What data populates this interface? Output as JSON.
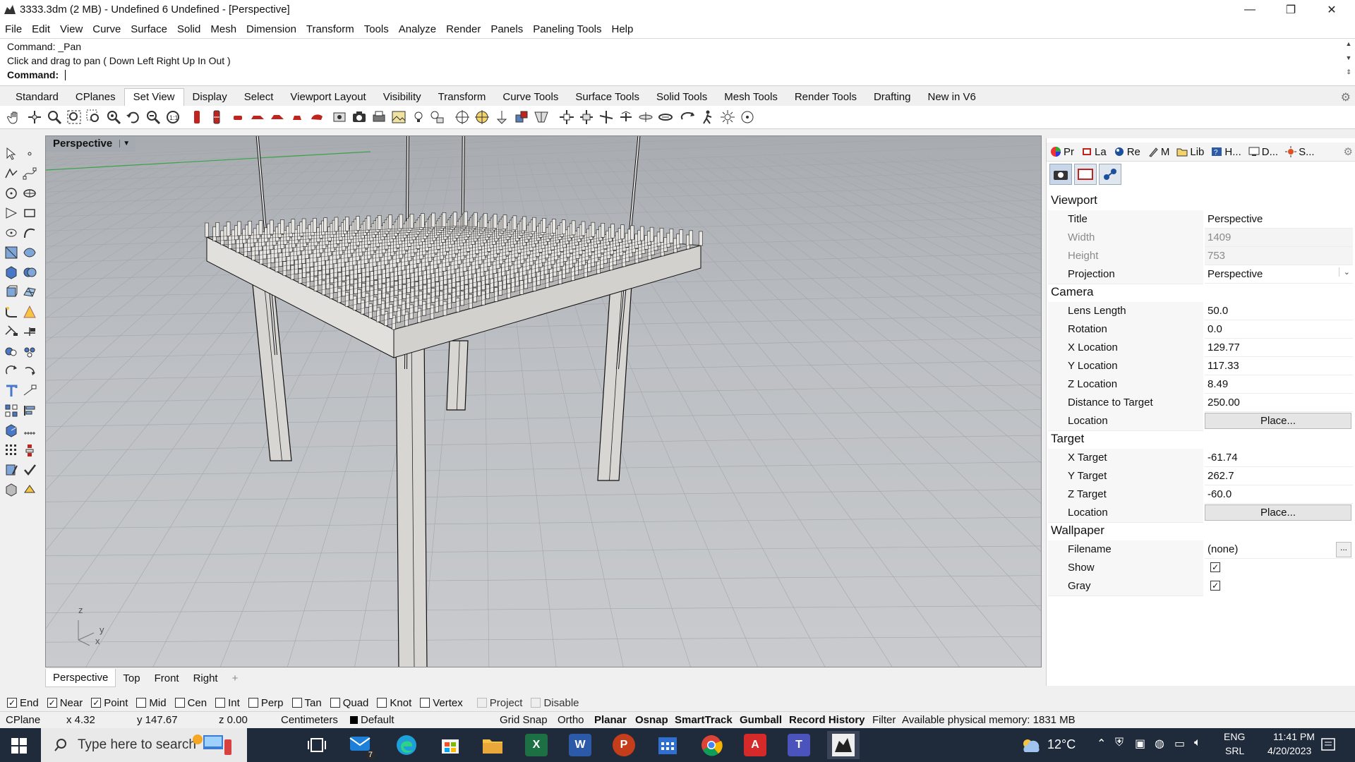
{
  "window": {
    "title": "3333.3dm (2 MB) - Undefined 6 Undefined - [Perspective]",
    "controls": [
      "—",
      "❐",
      "✕"
    ]
  },
  "menu": [
    "File",
    "Edit",
    "View",
    "Curve",
    "Surface",
    "Solid",
    "Mesh",
    "Dimension",
    "Transform",
    "Tools",
    "Analyze",
    "Render",
    "Panels",
    "Paneling Tools",
    "Help"
  ],
  "command": {
    "history_1": "Command: _Pan",
    "history_2": "Click and drag to pan ( Down  Left  Right  Up  In  Out )",
    "prompt_label": "Command:",
    "value": ""
  },
  "toolbar_tabs": [
    "Standard",
    "CPlanes",
    "Set View",
    "Display",
    "Select",
    "Viewport Layout",
    "Visibility",
    "Transform",
    "Curve Tools",
    "Surface Tools",
    "Solid Tools",
    "Mesh Tools",
    "Render Tools",
    "Drafting",
    "New in V6"
  ],
  "active_toolbar_tab": "Set View",
  "viewport": {
    "label": "Perspective",
    "axis_z": "z",
    "axis_y": "y",
    "axis_x": "x",
    "background_top": "#a8acb0",
    "background_bottom": "#c9cbce"
  },
  "viewport_tabs": [
    "Perspective",
    "Top",
    "Front",
    "Right"
  ],
  "viewport_tab_add": "+",
  "panel": {
    "tabs": [
      {
        "label": "Pr",
        "icon": "color-wheel-icon"
      },
      {
        "label": "La",
        "icon": "layers-icon"
      },
      {
        "label": "Re",
        "icon": "render-icon"
      },
      {
        "label": "M",
        "icon": "materials-icon"
      },
      {
        "label": "Lib",
        "icon": "folder-icon"
      },
      {
        "label": "H...",
        "icon": "help-icon"
      },
      {
        "label": "D...",
        "icon": "display-icon"
      },
      {
        "label": "S...",
        "icon": "sun-icon"
      }
    ],
    "sections": {
      "viewport": "Viewport",
      "camera": "Camera",
      "target": "Target",
      "wallpaper": "Wallpaper"
    },
    "fields": {
      "title_label": "Title",
      "title_value": "Perspective",
      "width_label": "Width",
      "width_value": "1409",
      "height_label": "Height",
      "height_value": "753",
      "projection_label": "Projection",
      "projection_value": "Perspective",
      "lens_label": "Lens Length",
      "lens_value": "50.0",
      "rotation_label": "Rotation",
      "rotation_value": "0.0",
      "xloc_label": "X Location",
      "xloc_value": "129.77",
      "yloc_label": "Y Location",
      "yloc_value": "117.33",
      "zloc_label": "Z Location",
      "zloc_value": "8.49",
      "dist_label": "Distance to Target",
      "dist_value": "250.00",
      "cam_location_label": "Location",
      "place_label": "Place...",
      "xt_label": "X Target",
      "xt_value": "-61.74",
      "yt_label": "Y Target",
      "yt_value": "262.7",
      "zt_label": "Z Target",
      "zt_value": "-60.0",
      "tgt_location_label": "Location",
      "filename_label": "Filename",
      "filename_value": "(none)",
      "filename_browse": "...",
      "show_label": "Show",
      "show_checked": true,
      "gray_label": "Gray",
      "gray_checked": true
    }
  },
  "osnaps": [
    {
      "label": "End",
      "checked": true,
      "enabled": true
    },
    {
      "label": "Near",
      "checked": true,
      "enabled": true
    },
    {
      "label": "Point",
      "checked": true,
      "enabled": true
    },
    {
      "label": "Mid",
      "checked": false,
      "enabled": true
    },
    {
      "label": "Cen",
      "checked": false,
      "enabled": true
    },
    {
      "label": "Int",
      "checked": false,
      "enabled": true
    },
    {
      "label": "Perp",
      "checked": false,
      "enabled": true
    },
    {
      "label": "Tan",
      "checked": false,
      "enabled": true
    },
    {
      "label": "Quad",
      "checked": false,
      "enabled": true
    },
    {
      "label": "Knot",
      "checked": false,
      "enabled": true
    },
    {
      "label": "Vertex",
      "checked": false,
      "enabled": true
    },
    {
      "label": "Project",
      "checked": false,
      "enabled": false
    },
    {
      "label": "Disable",
      "checked": false,
      "enabled": false
    }
  ],
  "status": {
    "cplane": "CPlane",
    "x": "x 4.32",
    "y": "y 147.67",
    "z": "z 0.00",
    "units": "Centimeters",
    "layer": "Default",
    "grid_snap": "Grid Snap",
    "ortho": "Ortho",
    "planar": "Planar",
    "osnap": "Osnap",
    "smarttrack": "SmartTrack",
    "gumball": "Gumball",
    "record_history": "Record History",
    "filter": "Filter",
    "memory": "Available physical memory: 1831 MB"
  },
  "taskbar": {
    "search_placeholder": "Type here to search",
    "mail_badge": "7",
    "weather": "12°C",
    "lang_1": "ENG",
    "lang_2": "SRL",
    "time": "11:41 PM",
    "date": "4/20/2023",
    "excel_letter": "X",
    "word_letter": "W",
    "ppt_letter": "P",
    "acrobat_letter": "A",
    "teams_letter": "T"
  }
}
